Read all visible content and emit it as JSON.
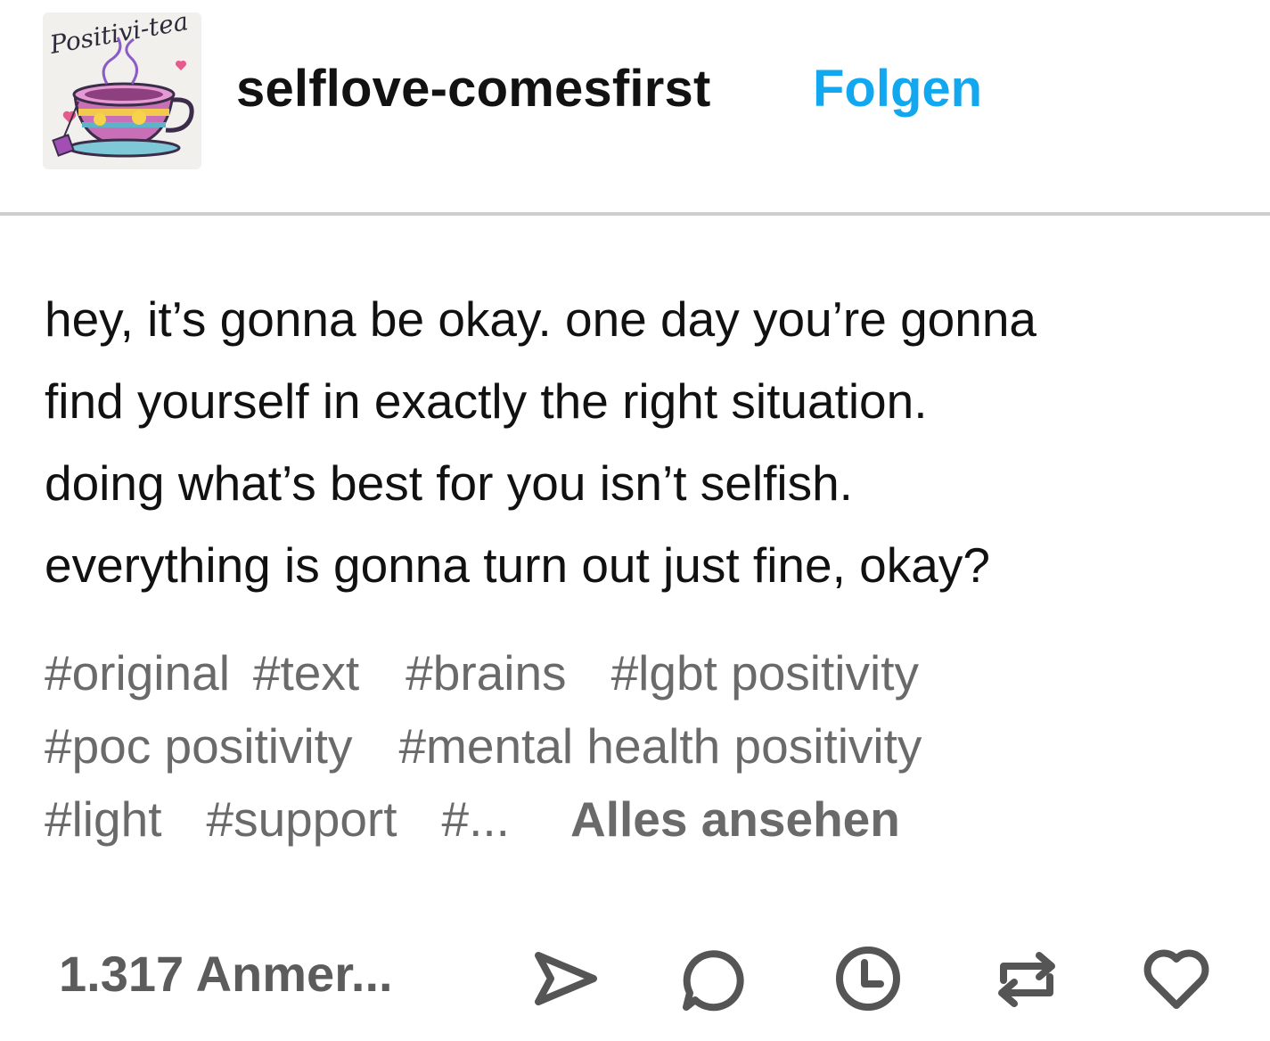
{
  "header": {
    "avatar_label": "Positivi-tea",
    "blog_name": "selflove-comesfirst",
    "follow_label": "Folgen"
  },
  "post": {
    "lines": [
      "hey, it’s gonna be okay. one day you’re gonna",
      "find yourself in exactly the right situation.",
      "doing what’s best for you isn’t selfish.",
      "everything is gonna turn out just fine, okay?"
    ],
    "tags": [
      [
        "#original",
        "#text",
        "#brains",
        "#lgbt positivity"
      ],
      [
        "#poc positivity",
        "#mental health positivity"
      ],
      [
        "#light",
        "#support",
        "#..."
      ]
    ],
    "see_all_label": "Alles ansehen"
  },
  "footer": {
    "notes_label": "1.317 Anmer...",
    "actions": [
      "share-icon",
      "reply-icon",
      "history-icon",
      "reblog-icon",
      "like-icon"
    ],
    "icon_color": "#555555"
  },
  "colors": {
    "accent": "#11a8f0",
    "tag_gray": "#6a6a6a",
    "divider": "#cfcfcf"
  }
}
